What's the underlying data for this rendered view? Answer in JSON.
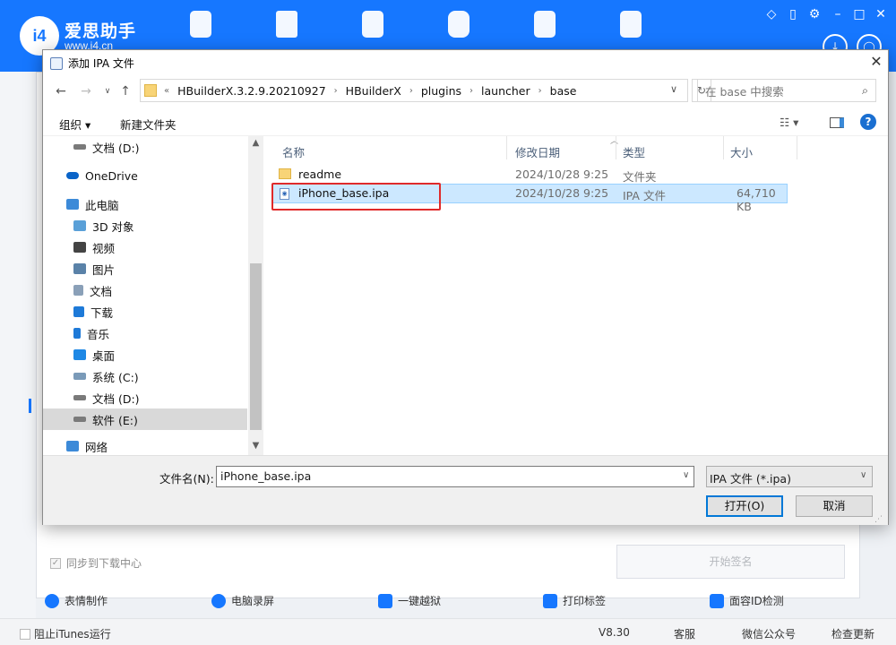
{
  "app": {
    "logo_badge": "i4",
    "title": "爱思助手",
    "url": "www.i4.cn",
    "accent": "#1677ff",
    "sync_label": "同步到下载中心",
    "start_sign_label": "开始签名",
    "tools": [
      "表情制作",
      "电脑录屏",
      "一键越狱",
      "打印标签",
      "面容ID检测"
    ],
    "status": {
      "block_itunes": "阻止iTunes运行",
      "version": "V8.30",
      "support": "客服",
      "wechat": "微信公众号",
      "check_update": "检查更新"
    }
  },
  "dialog": {
    "title": "添加 IPA 文件",
    "close_glyph": "✕",
    "address": {
      "overflow": "«",
      "crumbs": [
        "HBuilderX.3.2.9.20210927",
        "HBuilderX",
        "plugins",
        "launcher",
        "base"
      ]
    },
    "search_placeholder": "在 base 中搜索",
    "toolbar": {
      "organize": "组织 ▾",
      "new_folder": "新建文件夹"
    },
    "nav_items": [
      {
        "label": "文档 (D:)",
        "icon": "drive-icon",
        "color": "#7a7a7a"
      },
      {
        "label": "OneDrive",
        "icon": "cloud-icon",
        "color": "#0a64c8"
      },
      {
        "label": "此电脑",
        "icon": "computer-icon",
        "color": "#3c8ad8"
      },
      {
        "label": "3D 对象",
        "icon": "cube-icon",
        "color": "#5aa0d8"
      },
      {
        "label": "视频",
        "icon": "video-icon",
        "color": "#444444"
      },
      {
        "label": "图片",
        "icon": "picture-icon",
        "color": "#5a82a8"
      },
      {
        "label": "文档",
        "icon": "document-icon",
        "color": "#8aa0b8"
      },
      {
        "label": "下载",
        "icon": "download-icon",
        "color": "#1e7ad8"
      },
      {
        "label": "音乐",
        "icon": "music-icon",
        "color": "#1e7ad8"
      },
      {
        "label": "桌面",
        "icon": "desktop-icon",
        "color": "#1e88e5"
      },
      {
        "label": "系统 (C:)",
        "icon": "drive-icon",
        "color": "#7a9ab8"
      },
      {
        "label": "文档 (D:)",
        "icon": "drive-icon",
        "color": "#7a7a7a"
      },
      {
        "label": "软件 (E:)",
        "icon": "drive-icon",
        "color": "#7a7a7a"
      },
      {
        "label": "网络",
        "icon": "network-icon",
        "color": "#3c8ad8"
      }
    ],
    "columns": {
      "name": "名称",
      "modified": "修改日期",
      "type": "类型",
      "size": "大小"
    },
    "files": [
      {
        "name": "readme",
        "modified": "2024/10/28 9:25",
        "type": "文件夹",
        "size": "",
        "icon": "folder-icon"
      },
      {
        "name": "iPhone_base.ipa",
        "modified": "2024/10/28 9:25",
        "type": "IPA 文件",
        "size": "64,710 KB",
        "icon": "ipa-file-icon"
      }
    ],
    "filename_label": "文件名(N):",
    "filename_value": "iPhone_base.ipa",
    "filetype_value": "IPA 文件 (*.ipa)",
    "open_label": "打开(O)",
    "cancel_label": "取消"
  }
}
